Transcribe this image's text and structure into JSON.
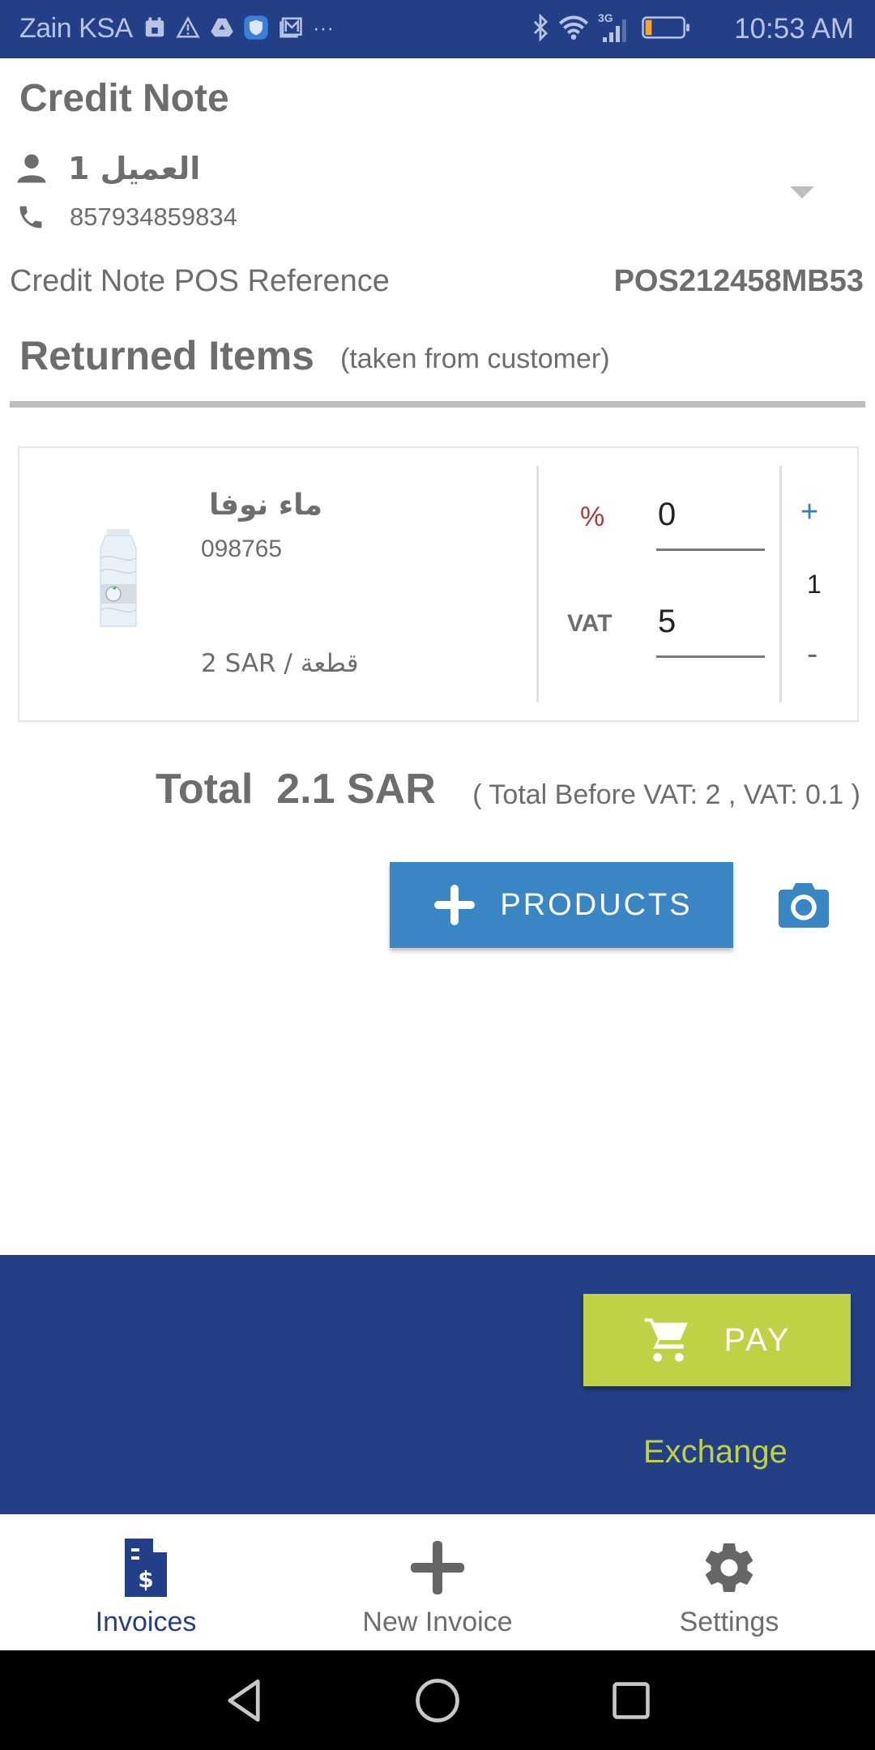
{
  "status_bar": {
    "carrier": "Zain KSA",
    "time": "10:53 AM",
    "network": "3G",
    "more_indicator": "···",
    "left_icons": [
      "calendar-icon",
      "warning-icon",
      "drive-icon",
      "shield-icon",
      "gallery-icon"
    ],
    "right_icons": [
      "bluetooth-icon",
      "wifi-icon",
      "signal-icon",
      "battery-icon"
    ],
    "battery_color": "#f5a623"
  },
  "header": {
    "title": "Credit Note",
    "customer_name": "العميل 1",
    "customer_phone": "857934859834",
    "reference_label": "Credit Note POS Reference",
    "reference_value": "POS212458MB53"
  },
  "returned_items": {
    "title": "Returned Items",
    "subtitle": "(taken from customer)",
    "items": [
      {
        "name": "ماء نوفا",
        "code": "098765",
        "price": "2 SAR / قطعة",
        "discount_label": "%",
        "discount_value": "0",
        "vat_label": "VAT",
        "vat_value": "5",
        "quantity": "1",
        "increment_label": "+",
        "decrement_label": "-"
      }
    ]
  },
  "totals": {
    "total": "Total  2.1 SAR",
    "breakdown": "( Total Before VAT: 2 , VAT: 0.1 )"
  },
  "actions": {
    "products_label": "PRODUCTS",
    "pay_label": "PAY",
    "exchange_label": "Exchange"
  },
  "tabs": [
    {
      "label": "Invoices",
      "icon": "invoice-icon",
      "active": true
    },
    {
      "label": "New Invoice",
      "icon": "plus-icon",
      "active": false
    },
    {
      "label": "Settings",
      "icon": "gear-icon",
      "active": false
    }
  ],
  "colors": {
    "primary": "#233f88",
    "accent": "#bfd145",
    "button_blue": "#3a85c4",
    "discount_red": "#b23a3a"
  }
}
